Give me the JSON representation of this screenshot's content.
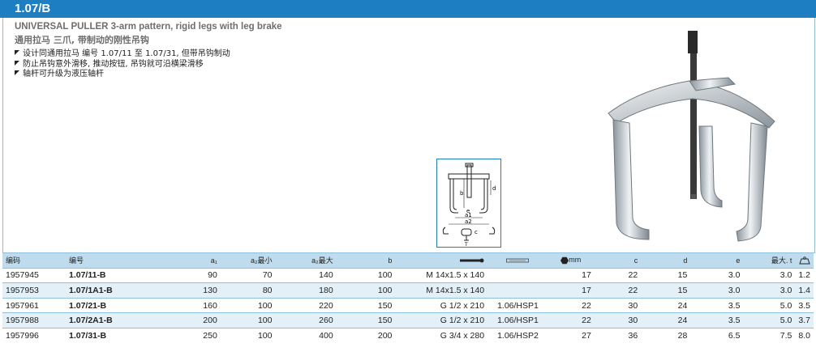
{
  "header": {
    "code": "1.07/B"
  },
  "title": {
    "en": "UNIVERSAL PULLER 3-arm pattern, rigid legs with leg brake",
    "cn": "通用拉马  三爪, 带制动的刚性吊钩"
  },
  "bullets": [
    "设计同通用拉马 编号 1.07/11 至 1.07/31, 但带吊钩制动",
    "防止吊钩意外滑移, 推动按钮, 吊钩就可沿横梁滑移",
    "轴杆可升级为液压轴杆"
  ],
  "diagram": {
    "labels": {
      "b": "b",
      "d": "d",
      "e": "e",
      "a1": "a1",
      "a2": "a2",
      "c": "c",
      "t": "T"
    }
  },
  "table": {
    "headers": {
      "code": "编码",
      "number": "编号",
      "a1": "a₁",
      "a2min": "a₂最小",
      "a2max": "a₂最大",
      "b": "b",
      "spindle_icon": "spindle-icon",
      "hydraulic_icon": "hydraulic-spindle-icon",
      "mm_label": "mm",
      "mm_icon": "hex-nut-icon",
      "c": "c",
      "d": "d",
      "e": "e",
      "t": "最大. t",
      "weight_icon": "weight-icon"
    },
    "rows": [
      {
        "code": "1957945",
        "number": "1.07/11-B",
        "a1": "90",
        "a2min": "70",
        "a2max": "140",
        "b": "100",
        "thread": "M 14x1.5 x 140",
        "hyd": "",
        "mm": "17",
        "c": "22",
        "d": "15",
        "e": "3.0",
        "t": "3.0",
        "w": "1.2"
      },
      {
        "code": "1957953",
        "number": "1.07/1A1-B",
        "a1": "130",
        "a2min": "80",
        "a2max": "180",
        "b": "100",
        "thread": "M 14x1.5 x 140",
        "hyd": "",
        "mm": "17",
        "c": "22",
        "d": "15",
        "e": "3.0",
        "t": "3.0",
        "w": "1.4"
      },
      {
        "code": "1957961",
        "number": "1.07/21-B",
        "a1": "160",
        "a2min": "100",
        "a2max": "220",
        "b": "150",
        "thread": "G 1/2 x 210",
        "hyd": "1.06/HSP1",
        "mm": "22",
        "c": "30",
        "d": "24",
        "e": "3.5",
        "t": "5.0",
        "w": "3.5"
      },
      {
        "code": "1957988",
        "number": "1.07/2A1-B",
        "a1": "200",
        "a2min": "100",
        "a2max": "260",
        "b": "150",
        "thread": "G 1/2 x 210",
        "hyd": "1.06/HSP1",
        "mm": "22",
        "c": "30",
        "d": "24",
        "e": "3.5",
        "t": "5.0",
        "w": "3.7"
      },
      {
        "code": "1957996",
        "number": "1.07/31-B",
        "a1": "250",
        "a2min": "100",
        "a2max": "400",
        "b": "200",
        "thread": "G 3/4 x 280",
        "hyd": "1.06/HSP2",
        "mm": "27",
        "c": "36",
        "d": "28",
        "e": "6.5",
        "t": "7.5",
        "w": "8.0"
      }
    ]
  },
  "colors": {
    "header_blue": "#1d7fc1",
    "table_header": "#bfdcee",
    "row_alt": "#e3f0f8"
  }
}
